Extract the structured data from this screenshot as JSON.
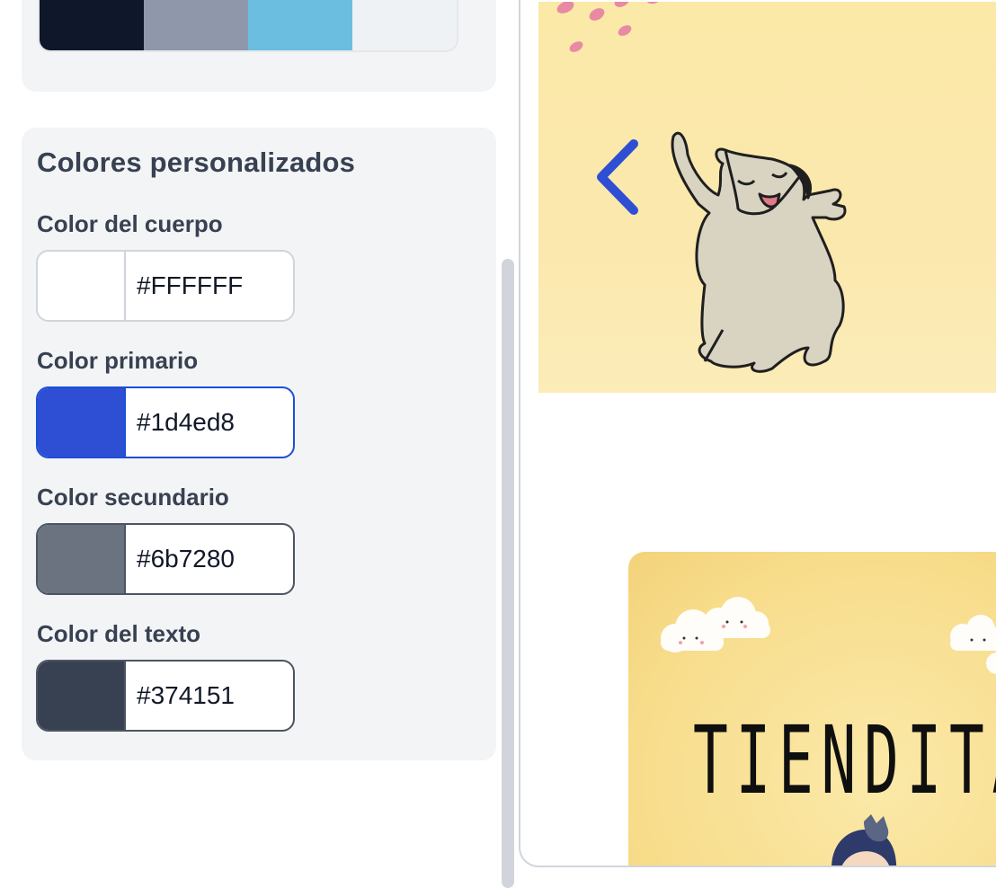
{
  "theme_palette": {
    "swatches": [
      "#0f172a",
      "#8e98aa",
      "#6bbee0",
      "#eef2f4"
    ]
  },
  "custom_colors": {
    "title": "Colores personalizados",
    "fields": [
      {
        "label": "Color del cuerpo",
        "value": "#FFFFFF",
        "swatch": "#ffffff"
      },
      {
        "label": "Color primario",
        "value": "#1d4ed8",
        "swatch": "#2e4fd3"
      },
      {
        "label": "Color secundario",
        "value": "#6b7280",
        "swatch": "#6b7280"
      },
      {
        "label": "Color del texto",
        "value": "#374151",
        "swatch": "#374151"
      }
    ]
  },
  "preview": {
    "banner_text": "TIENDITA",
    "arrow_icon": "chevron-left-icon",
    "arrow_color": "#2e4fd3",
    "slide_bg": "#fbe8ad"
  }
}
